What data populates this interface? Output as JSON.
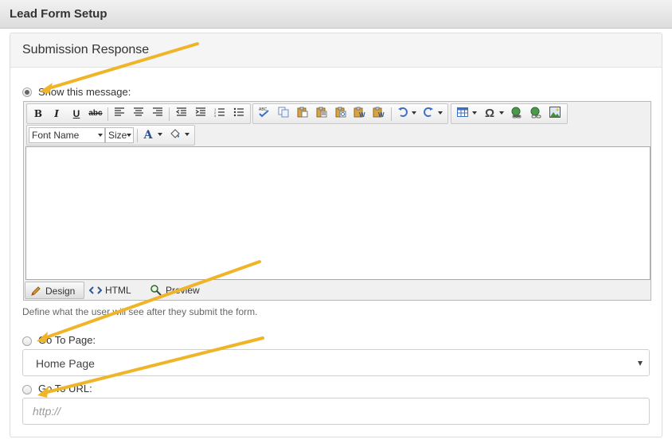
{
  "window": {
    "title": "Lead Form Setup"
  },
  "panel": {
    "title": "Submission Response"
  },
  "options": {
    "show_message": {
      "label": "Show this message:",
      "selected": true
    },
    "go_to_page": {
      "label": "Go To Page:",
      "selected": false,
      "value": "Home Page"
    },
    "go_to_url": {
      "label": "Go To URL:",
      "selected": false,
      "placeholder": "http://"
    }
  },
  "editor": {
    "toolbar_row1": [
      "bold",
      "italic",
      "underline",
      "strikethrough",
      "align-left",
      "align-center",
      "align-right",
      "outdent",
      "indent",
      "ordered-list",
      "unordered-list",
      "spell-check",
      "copy",
      "paste",
      "paste-text",
      "paste-html",
      "paste-word",
      "paste-format",
      "undo",
      "redo",
      "table",
      "symbol",
      "insert-link",
      "remove-link",
      "insert-image"
    ],
    "bold": "B",
    "italic": "I",
    "underline": "U",
    "strike": "abc",
    "font_name": "Font Name",
    "size": "Size",
    "font_color_glyph": "A",
    "omega_glyph": "Ω",
    "modes": {
      "design": "Design",
      "html": "HTML",
      "preview": "Preview"
    },
    "active_mode": "design"
  },
  "help_text": "Define what the user will see after they submit the form.",
  "annotation_color": "#f0b429"
}
